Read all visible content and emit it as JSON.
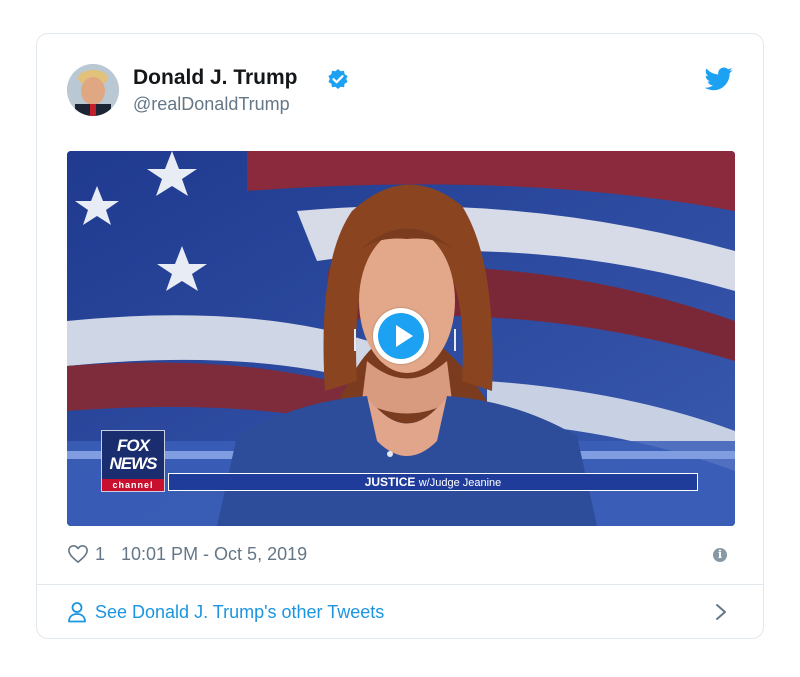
{
  "tweet": {
    "author_name": "Donald J. Trump",
    "author_handle": "@realDonaldTrump",
    "verified": true,
    "like_count": "1",
    "timestamp": "10:01 PM - Oct 5, 2019"
  },
  "media": {
    "type": "video",
    "network_logo_line1": "FOX",
    "network_logo_line2": "NEWS",
    "network_logo_line3": "channel",
    "lower_third_show": "JUSTICE",
    "lower_third_host": "w/Judge Jeanine"
  },
  "footer": {
    "link_label": "See Donald J. Trump's other Tweets"
  },
  "icons": {
    "bird": "twitter-bird-icon",
    "verified": "verified-badge-icon",
    "heart": "heart-icon",
    "info": "info-icon",
    "person": "person-icon",
    "chevron": "chevron-right-icon",
    "play": "play-icon"
  },
  "colors": {
    "brand_blue": "#1da1f2",
    "link_blue": "#1b95e0",
    "muted_text": "#657786",
    "border": "#e1e8ed"
  }
}
